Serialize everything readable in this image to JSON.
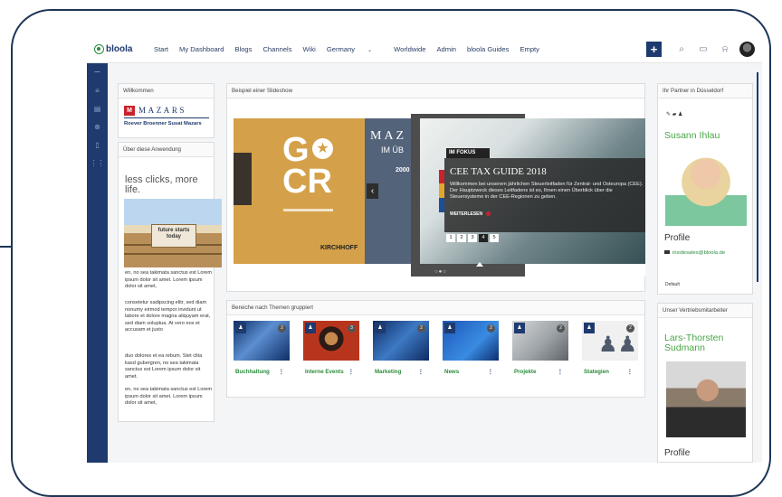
{
  "nav": {
    "brand": "bloola",
    "items": [
      "Start",
      "My Dashboard",
      "Blogs",
      "Channels",
      "Wiki",
      "Germany",
      "Worldwide",
      "Admin",
      "bloola Guides",
      "Empty"
    ],
    "caret": "⌄"
  },
  "tools": {
    "plus": "+",
    "search_icon": "⌕",
    "chat_icon": "▭",
    "bell_icon": "⍾"
  },
  "rail": {
    "icons": [
      "⏤",
      "≡",
      "▤",
      "⊗",
      "▯",
      "⋮⋮"
    ]
  },
  "left": {
    "willkommen_title": "Willkommen",
    "mazars_logo_letter": "M",
    "mazars_logo_text": "MAZARS",
    "mazars_sub": "Roever Broenner Susat Mazars",
    "about_title": "Über diese Anwendung",
    "headline": "less clicks, more life.",
    "dock_sign": "future starts today",
    "para1": "en, no sea takimata sanctus est Lorem ipsum dolor sit amet. Lorem ipsum dolor sit amet,",
    "para2": "consetetur sadipscing elitr, sed diam nonumy eirmod tempor invidunt ut labore et dolore magna aliquyam erat, sed diam voluptua. At vero eos et accusam et justo",
    "para3": "duo dolores et ea rebum. Stet clita kasd gubergren, no sea takimata sanctus est Lorem ipsum dolor sit amet.",
    "para4": "en, no sea takimata sanctus est Lorem ipsum dolor sit amet. Lorem ipsum dolor sit amet,"
  },
  "slideshow": {
    "title": "Beispiel einer Slideshow",
    "gocr_g": "G",
    "gocr_cr": "CR",
    "kirchhoff": "KIRCHHOFF",
    "mazars_slide_title": "MAZ",
    "mazars_slide_sub": "IM ÜB",
    "mazars_slide_year": "2000",
    "arrow_prev": "‹",
    "fokus_label": "IM FOKUS",
    "fokus_title": "CEE TAX GUIDE 2018",
    "fokus_text": "Willkommen bei unserem jährlichen Steuerleitfaden für Zentral- und Osteuropa (CEE). Der Hauptzweck dieses Leitfadens ist es, Ihnen einen Überblick über die Steuersysteme in der CEE-Regionen zu geben.",
    "weiterlesen": "WEITERLESEN",
    "pages": [
      "1",
      "2",
      "3",
      "4",
      "5"
    ],
    "active_page": "4",
    "dots": "○●○"
  },
  "themes": {
    "title": "Bereiche nach Themen gruppiert",
    "tiles": [
      {
        "label": "Buchhaltung",
        "badge": "2"
      },
      {
        "label": "Interne Events",
        "badge": "3"
      },
      {
        "label": "Marketing",
        "badge": "2"
      },
      {
        "label": "News",
        "badge": "2"
      },
      {
        "label": "Projekte",
        "badge": "2"
      },
      {
        "label": "Stategien",
        "badge": "2"
      }
    ],
    "kebab": "⋮"
  },
  "right": {
    "partner_title": "Ihr Partner in Düsseldorf",
    "partner_icons": "✎ ▰ ♟",
    "partner_name": "Susann Ihlau",
    "profile": "Profile",
    "partner_email": "insidesales@bloola.de",
    "default_label": "Default",
    "sales_title": "Unser Vertriebsmitarbeiter",
    "sales_name": "Lars-Thorsten Sudmann",
    "sales_profile": "Profile"
  }
}
